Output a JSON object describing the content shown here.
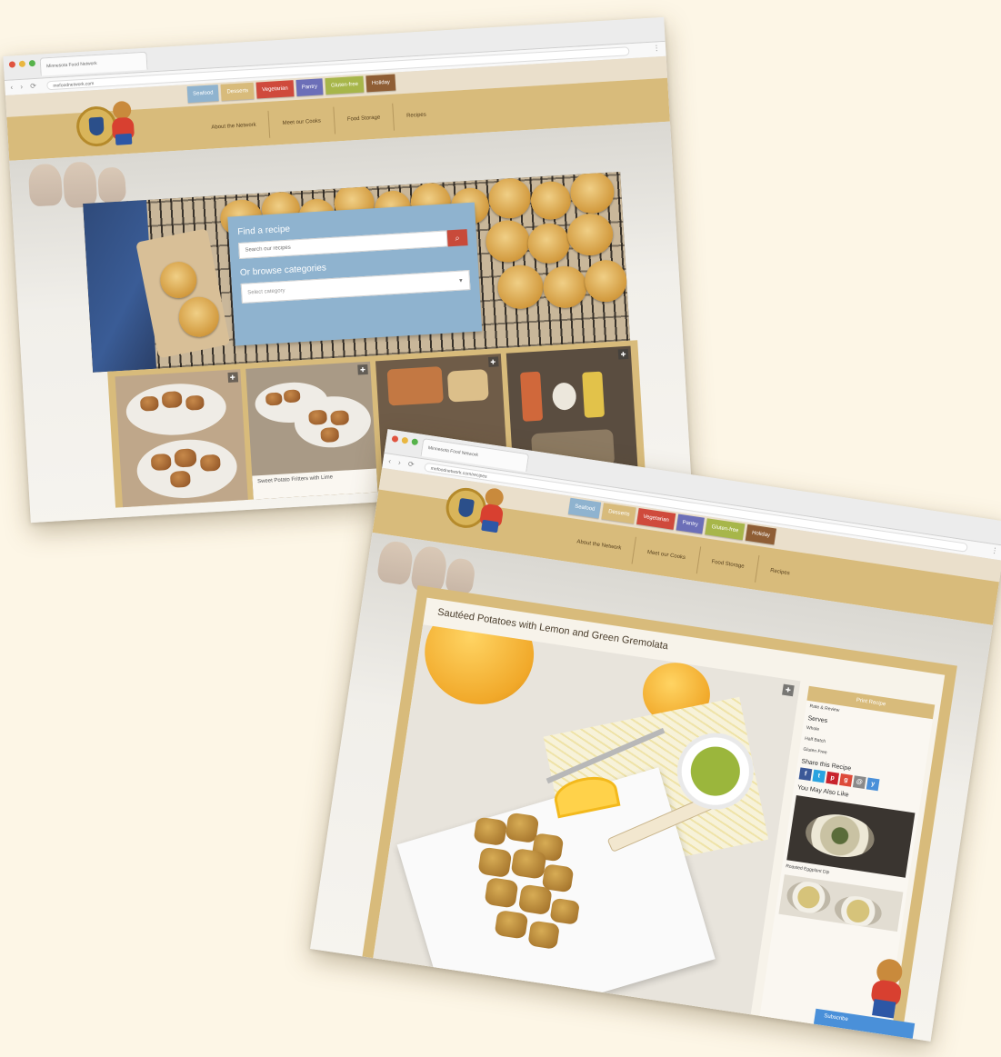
{
  "colors": {
    "background": "#fdf6e6",
    "gold": "#d8bb7b",
    "search_blue": "#8fb3cf",
    "search_red": "#c84a3a"
  },
  "screenshot1": {
    "browser_tab": "Minnesota Food Network",
    "url": "mnfoodnetwork.com",
    "categories": [
      {
        "label": "Seafood",
        "color": "#8fb3cf"
      },
      {
        "label": "Desserts",
        "color": "#d8bb7b"
      },
      {
        "label": "Vegetarian",
        "color": "#cf4a3c"
      },
      {
        "label": "Pantry",
        "color": "#6c6fb8"
      },
      {
        "label": "Gluten-free",
        "color": "#a7b64a"
      },
      {
        "label": "Holiday",
        "color": "#8f5e35"
      }
    ],
    "nav": [
      "About the Network",
      "Meet our Cooks",
      "Food Storage",
      "Recipes"
    ],
    "search_label": "Find a recipe",
    "search_placeholder": "Search our recipes",
    "browse_label": "Or browse categories",
    "browse_value": "Select category",
    "thumb_caption": "Sweet Potato Fritters with Lime"
  },
  "screenshot2": {
    "browser_tab": "Minnesota Food Network",
    "url": "mnfoodnetwork.com/recipes",
    "categories": [
      {
        "label": "Seafood",
        "color": "#8fb3cf"
      },
      {
        "label": "Desserts",
        "color": "#d8bb7b"
      },
      {
        "label": "Vegetarian",
        "color": "#cf4a3c"
      },
      {
        "label": "Pantry",
        "color": "#6c6fb8"
      },
      {
        "label": "Gluten-free",
        "color": "#a7b64a"
      },
      {
        "label": "Holiday",
        "color": "#8f5e35"
      }
    ],
    "nav": [
      "About the Network",
      "Meet our Cooks",
      "Food Storage",
      "Recipes"
    ],
    "post_title": "Sautéed Potatoes with Lemon and Green Gremolata",
    "sidebar": {
      "head": "Print Recipe",
      "subtext": "Rate & Review",
      "serves_title": "Serves",
      "serves_lines": [
        "Whole",
        "Half Batch",
        "Gluten Free"
      ],
      "share_title": "Share this Recipe",
      "socials": [
        {
          "icon": "f",
          "color": "#3b5998"
        },
        {
          "icon": "t",
          "color": "#2aa3e0"
        },
        {
          "icon": "p",
          "color": "#c8232c"
        },
        {
          "icon": "g",
          "color": "#dd4b39"
        },
        {
          "icon": "@",
          "color": "#8a8a8a"
        },
        {
          "icon": "y",
          "color": "#4a90d9"
        }
      ],
      "also_like": "You May Also Like",
      "related_caption": "Roasted Eggplant Dip"
    },
    "bottom_bar": "Subscribe"
  }
}
